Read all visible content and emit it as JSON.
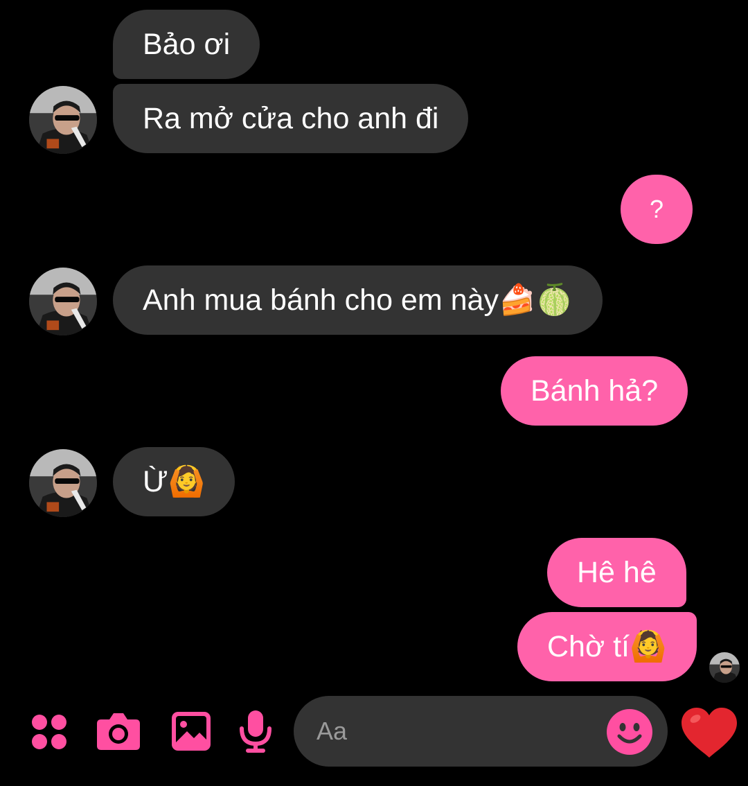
{
  "colors": {
    "background": "#000000",
    "incoming_bubble": "#333333",
    "outgoing_bubble": "#ff62aa",
    "accent": "#ff4fa1",
    "text": "#ffffff"
  },
  "messages": [
    {
      "sender": "contact",
      "text": "Bảo ơi"
    },
    {
      "sender": "contact",
      "text": "Ra mở cửa cho anh đi"
    },
    {
      "sender": "me",
      "text": "?"
    },
    {
      "sender": "contact",
      "text": "Anh mua bánh cho em này",
      "emoji": "🍰🍈"
    },
    {
      "sender": "me",
      "text": "Bánh hả?"
    },
    {
      "sender": "contact",
      "text": "Ừ",
      "emoji": "🙆"
    },
    {
      "sender": "me",
      "text": "Hê hê"
    },
    {
      "sender": "me",
      "text": "Chờ tí",
      "emoji": "🙆"
    }
  ],
  "composer": {
    "placeholder": "Aa",
    "icons": [
      "apps-icon",
      "camera-icon",
      "gallery-icon",
      "microphone-icon",
      "emoji-icon",
      "heart-icon"
    ]
  }
}
